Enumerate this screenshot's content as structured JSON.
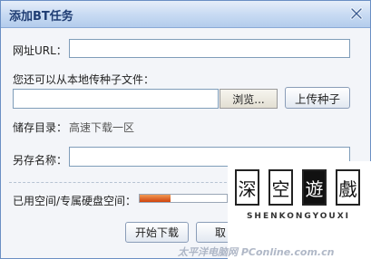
{
  "dialog": {
    "title": "添加BT任务",
    "close_icon": "close-x-icon"
  },
  "url_field": {
    "label": "网址URL：",
    "value": ""
  },
  "local_upload": {
    "label": "您还可以从本地传种子文件：",
    "file_value": "",
    "browse_label": "浏览...",
    "upload_label": "上传种子"
  },
  "storage": {
    "label": "储存目录：",
    "value": "高速下载一区"
  },
  "save_as": {
    "label": "另存名称：",
    "value": ""
  },
  "space": {
    "label": "已用空间/专属硬盘空间：",
    "used_fraction": 0.35,
    "bar_color": "#d0420c"
  },
  "actions": {
    "start_label": "开始下载",
    "cancel_label": "取"
  },
  "watermark": {
    "chars": [
      "深",
      "空",
      "遊",
      "戲"
    ],
    "latin": "SHENKONGYOUXI",
    "site_text": "太平洋电脑网 PConline.com.cn"
  }
}
